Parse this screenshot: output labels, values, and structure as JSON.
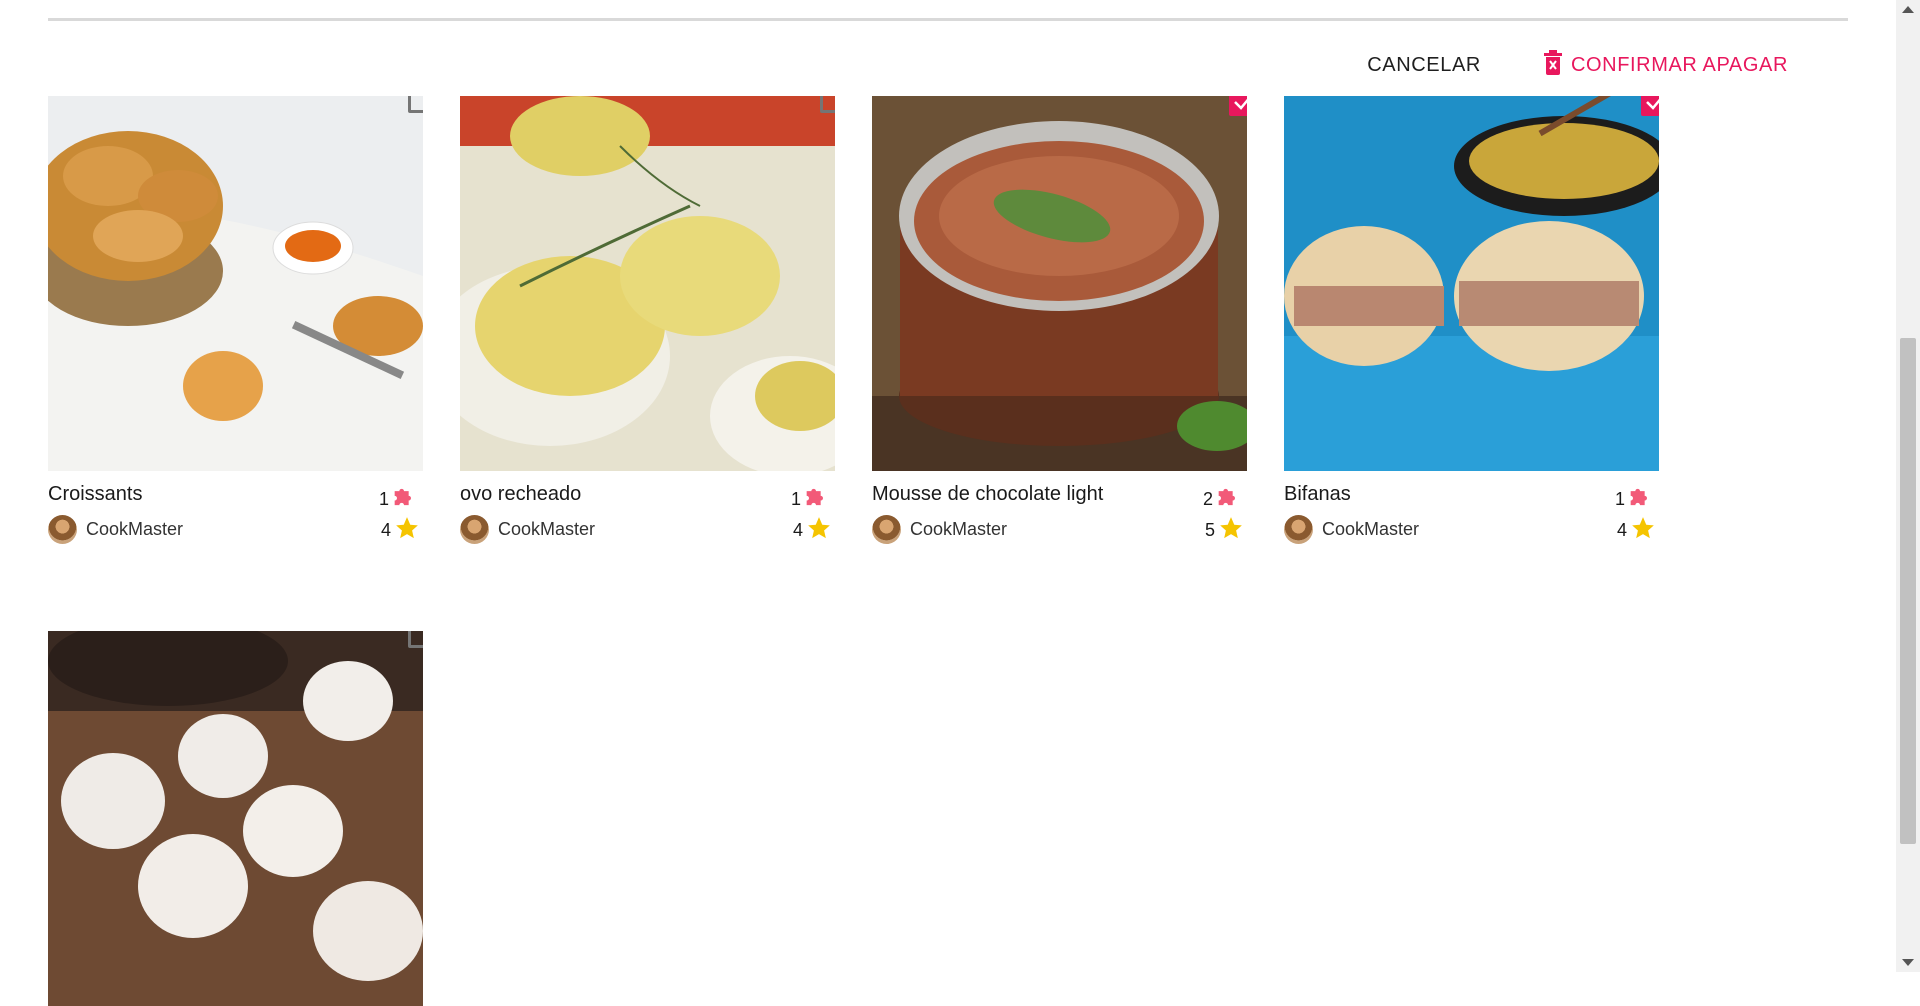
{
  "toolbar": {
    "cancel_label": "CANCELAR",
    "confirm_delete_label": "CONFIRMAR APAGAR"
  },
  "colors": {
    "accent": "#e8175d",
    "puzzle": "#f25a78",
    "star": "#f5c400",
    "checkbox": "#757575"
  },
  "recipes": [
    {
      "title": "Croissants",
      "author": "CookMaster",
      "ingredients_count": "1",
      "rating": "4",
      "selected": false
    },
    {
      "title": "ovo recheado",
      "author": "CookMaster",
      "ingredients_count": "1",
      "rating": "4",
      "selected": false
    },
    {
      "title": "Mousse de chocolate light",
      "author": "CookMaster",
      "ingredients_count": "2",
      "rating": "5",
      "selected": true
    },
    {
      "title": "Bifanas",
      "author": "CookMaster",
      "ingredients_count": "1",
      "rating": "4",
      "selected": true
    },
    {
      "title": "",
      "author": "",
      "ingredients_count": "",
      "rating": "",
      "selected": false
    }
  ]
}
